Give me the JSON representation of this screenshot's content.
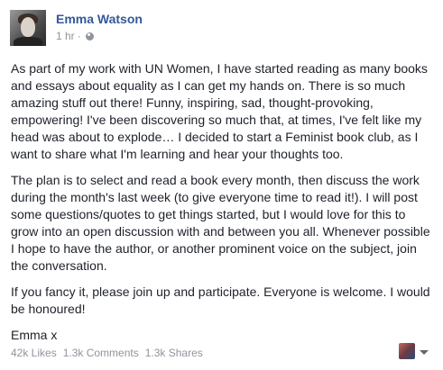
{
  "post": {
    "author": "Emma Watson",
    "time": "1 hr",
    "separator": "·",
    "paragraphs": [
      "As part of my work with UN Women, I have started reading as many books\nand essays about equality as I can get my hands on. There is so much\namazing stuff out there! Funny, inspiring, sad, thought-provoking,\nempowering! I've been discovering so much that, at times, I've felt like my\nhead was about to explode… I decided to start a Feminist book club, as I\nwant to share what I'm learning and hear your thoughts too.",
      "The plan is to select and read a book every month, then discuss the work\nduring the month's last week (to give everyone time to read it!). I will post\nsome questions/quotes to get things started, but I would love for this to\ngrow into an open discussion with and between you all. Whenever possible\nI hope to have the author, or another prominent voice on the subject, join\nthe conversation.",
      "If you fancy it, please join up and participate. Everyone is welcome. I would\nbe honoured!",
      "Emma x"
    ],
    "likes": "42k Likes",
    "comments": "1.3k Comments",
    "shares": "1.3k Shares"
  },
  "icons": {
    "avatar": "profile-photo",
    "audience": "globe-icon",
    "commenter": "profile-thumbnail",
    "menu": "chevron-down-icon"
  },
  "colors": {
    "name": "#365899",
    "meta": "#90949c",
    "text": "#1d2129"
  }
}
